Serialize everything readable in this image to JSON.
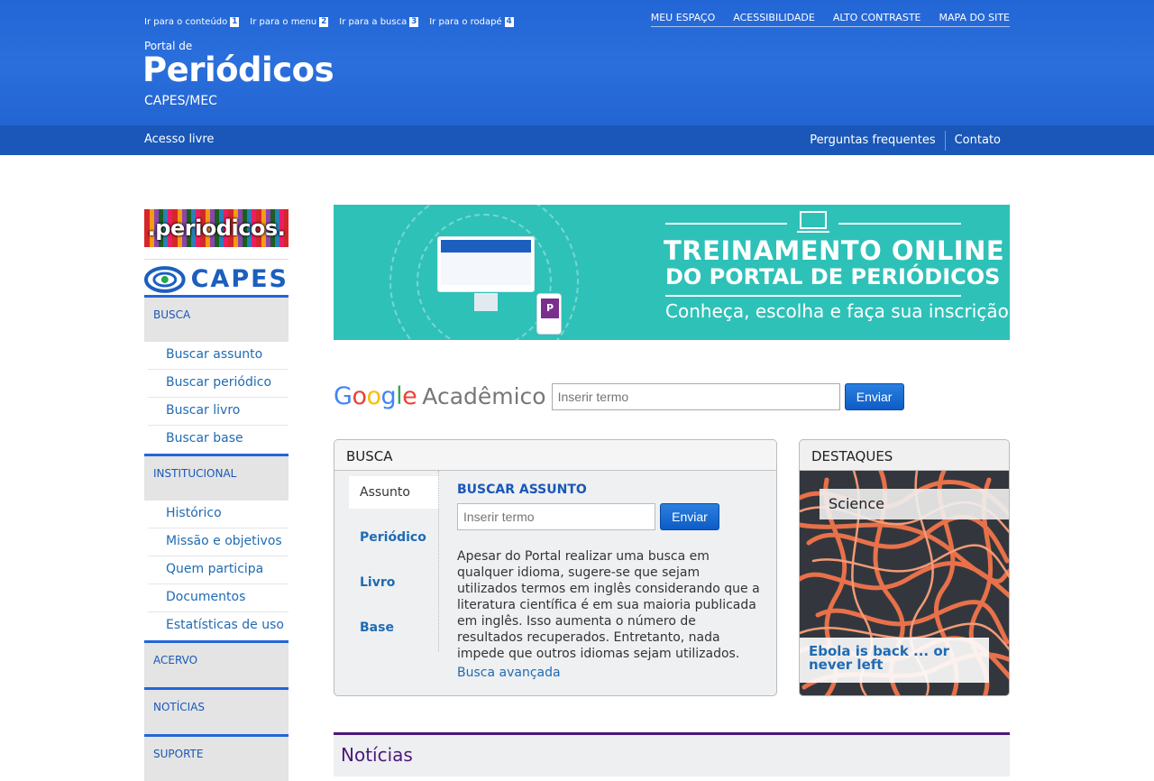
{
  "header": {
    "skip_links": [
      {
        "label": "Ir para o conteúdo",
        "key": "1"
      },
      {
        "label": "Ir para o menu",
        "key": "2"
      },
      {
        "label": "Ir para a busca",
        "key": "3"
      },
      {
        "label": "Ir para o rodapé",
        "key": "4"
      }
    ],
    "top_links": [
      "MEU ESPAÇO",
      "ACESSIBILIDADE",
      "ALTO CONTRASTE",
      "MAPA DO SITE"
    ],
    "brand_pre": "Portal de",
    "brand": "Periódicos",
    "brand_sub": "CAPES/MEC"
  },
  "navbar": {
    "left": "Acesso livre",
    "right": [
      "Perguntas frequentes",
      "Contato"
    ]
  },
  "sidebar": {
    "logo_periodicos": ".periodicos.",
    "logo_capes": "CAPES",
    "sections": [
      {
        "title": "BUSCA",
        "items": [
          "Buscar assunto",
          "Buscar periódico",
          "Buscar livro",
          "Buscar base"
        ]
      },
      {
        "title": "INSTITUCIONAL",
        "items": [
          "Histórico",
          "Missão e objetivos",
          "Quem participa",
          "Documentos",
          "Estatísticas de uso"
        ]
      },
      {
        "title": "ACERVO",
        "items": []
      },
      {
        "title": "NOTÍCIAS",
        "items": []
      },
      {
        "title": "SUPORTE",
        "items": []
      }
    ]
  },
  "banner": {
    "line1": "TREINAMENTO ONLINE",
    "line2": "DO PORTAL DE PERIÓDICOS",
    "line3": "Conheça, escolha e faça sua inscrição",
    "bg_color": "#2ec1b8"
  },
  "scholar": {
    "google": "Google",
    "academico": "Acadêmico",
    "placeholder": "Inserir termo",
    "button": "Enviar"
  },
  "busca": {
    "title": "BUSCA",
    "tabs": [
      "Assunto",
      "Periódico",
      "Livro",
      "Base"
    ],
    "heading": "BUSCAR ASSUNTO",
    "placeholder": "Inserir termo",
    "button": "Enviar",
    "description": "Apesar do Portal realizar uma busca em qualquer idioma, sugere-se que sejam utilizados termos em inglês considerando que a literatura científica é em sua maioria publicada em inglês. Isso aumenta o número de resultados recuperados. Entretanto, nada impede que outros idiomas sejam utilizados.",
    "advanced_link": "Busca avançada"
  },
  "destaques": {
    "title": "DESTAQUES",
    "label": "Science",
    "caption": "Ebola is back ... or never left"
  },
  "noticias": {
    "title": "Notícias"
  },
  "colors": {
    "header_blue": "#2366d6",
    "navbar_blue": "#1a57b8",
    "link_blue": "#1f6bb3",
    "noticias_purple": "#4a1a7a"
  }
}
